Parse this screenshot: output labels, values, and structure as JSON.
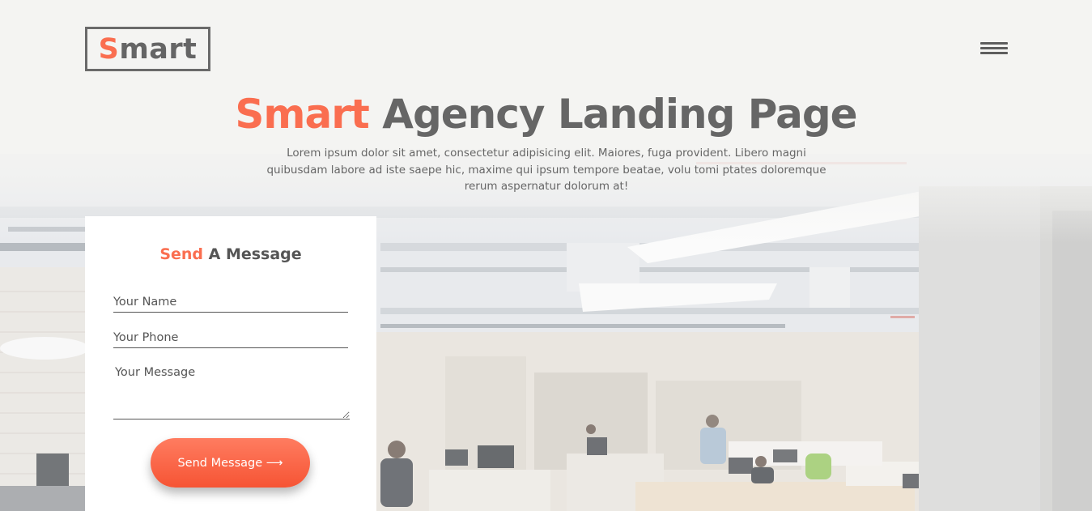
{
  "header": {
    "logo_accent": "S",
    "logo_rest": "mart",
    "menu_icon": "hamburger-menu-icon"
  },
  "hero": {
    "title_accent": "Smart",
    "title_rest": " Agency Landing Page",
    "description": "Lorem ipsum dolor sit amet, consectetur adipisicing elit. Maiores, fuga provident. Libero magni quibusdam labore ad iste saepe hic, maxime qui ipsum tempore beatae, volu tomi ptates doloremque rerum aspernatur dolorum at!"
  },
  "form": {
    "title_accent": "Send",
    "title_rest": " A Message",
    "name_placeholder": "Your Name",
    "phone_placeholder": "Your Phone",
    "message_placeholder": "Your Message",
    "submit_label": "Send Message ⟶"
  },
  "colors": {
    "accent": "#fa6e50",
    "text": "#666666",
    "background": "#f4f4f2"
  }
}
